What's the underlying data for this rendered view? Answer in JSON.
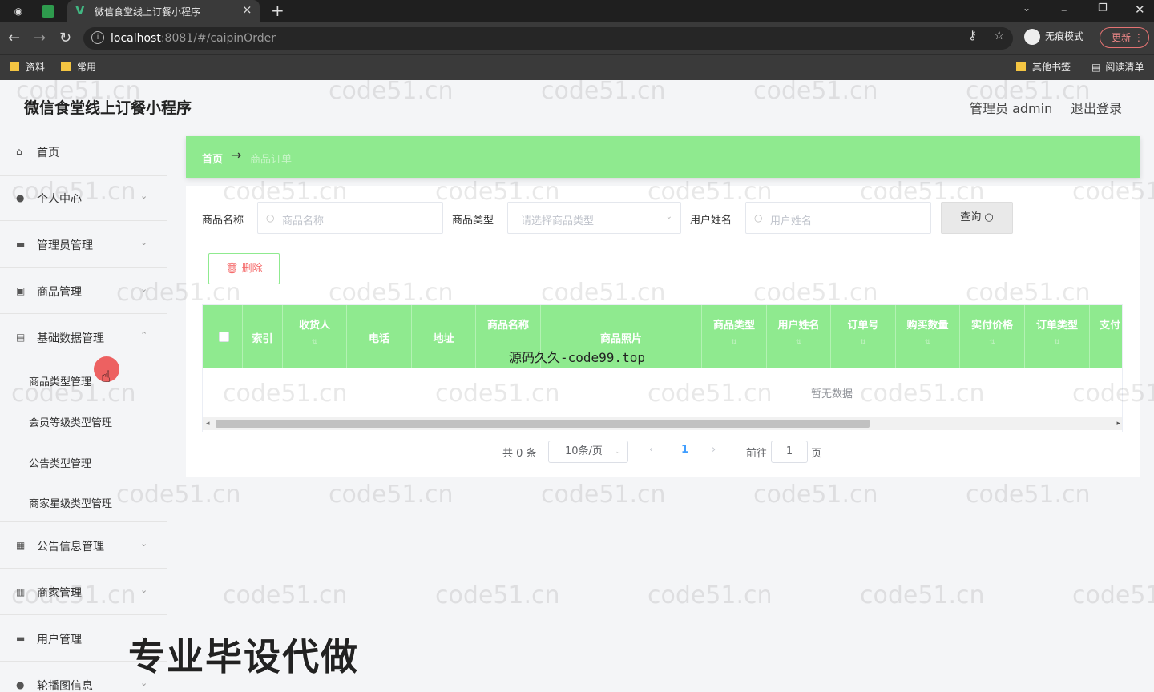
{
  "browser": {
    "tab_title": "微信食堂线上订餐小程序",
    "url_host": "localhost",
    "url_rest": ":8081/#/caipinOrder",
    "incognito_label": "无痕模式",
    "update_label": "更新",
    "bookmarks": [
      "资料",
      "常用"
    ],
    "other_bookmarks": "其他书签",
    "reading_list": "阅读清单"
  },
  "header": {
    "title": "微信食堂线上订餐小程序",
    "admin": "管理员 admin",
    "logout": "退出登录"
  },
  "sidebar": {
    "items": [
      {
        "label": "首页",
        "icon": "home-icon"
      },
      {
        "label": "个人中心",
        "icon": "user-icon"
      },
      {
        "label": "管理员管理",
        "icon": "admin-icon"
      },
      {
        "label": "商品管理",
        "icon": "goods-icon"
      },
      {
        "label": "基础数据管理",
        "icon": "data-icon"
      },
      {
        "label": "公告信息管理",
        "icon": "grid-icon"
      },
      {
        "label": "商家管理",
        "icon": "shop-icon"
      },
      {
        "label": "用户管理",
        "icon": "users-icon"
      },
      {
        "label": "轮播图信息",
        "icon": "carousel-icon"
      }
    ],
    "sub_items": [
      "商品类型管理",
      "会员等级类型管理",
      "公告类型管理",
      "商家星级类型管理"
    ]
  },
  "breadcrumb": {
    "home": "首页",
    "current": "商品订单"
  },
  "filters": {
    "goods_name_label": "商品名称",
    "goods_name_placeholder": "商品名称",
    "goods_type_label": "商品类型",
    "goods_type_placeholder": "请选择商品类型",
    "user_name_label": "用户姓名",
    "user_name_placeholder": "用户姓名",
    "query_label": "查询"
  },
  "actions": {
    "delete_label": "删除"
  },
  "table": {
    "columns": [
      "索引",
      "收货人",
      "电话",
      "地址",
      "商品名称",
      "商品照片",
      "商品类型",
      "用户姓名",
      "订单号",
      "购买数量",
      "实付价格",
      "订单类型",
      "支付"
    ],
    "empty_text": "暂无数据",
    "overlay_text": "源码久久-code99.top"
  },
  "pagination": {
    "total": "共 0 条",
    "page_size": "10条/页",
    "current_page": "1",
    "goto_label": "前往",
    "goto_value": "1",
    "unit": "页"
  },
  "watermark_text": "code51.cn",
  "promo_text": "专业毕设代做",
  "colors": {
    "accent": "#8fea8f",
    "danger": "#f56c6c",
    "page_link": "#409eff"
  }
}
